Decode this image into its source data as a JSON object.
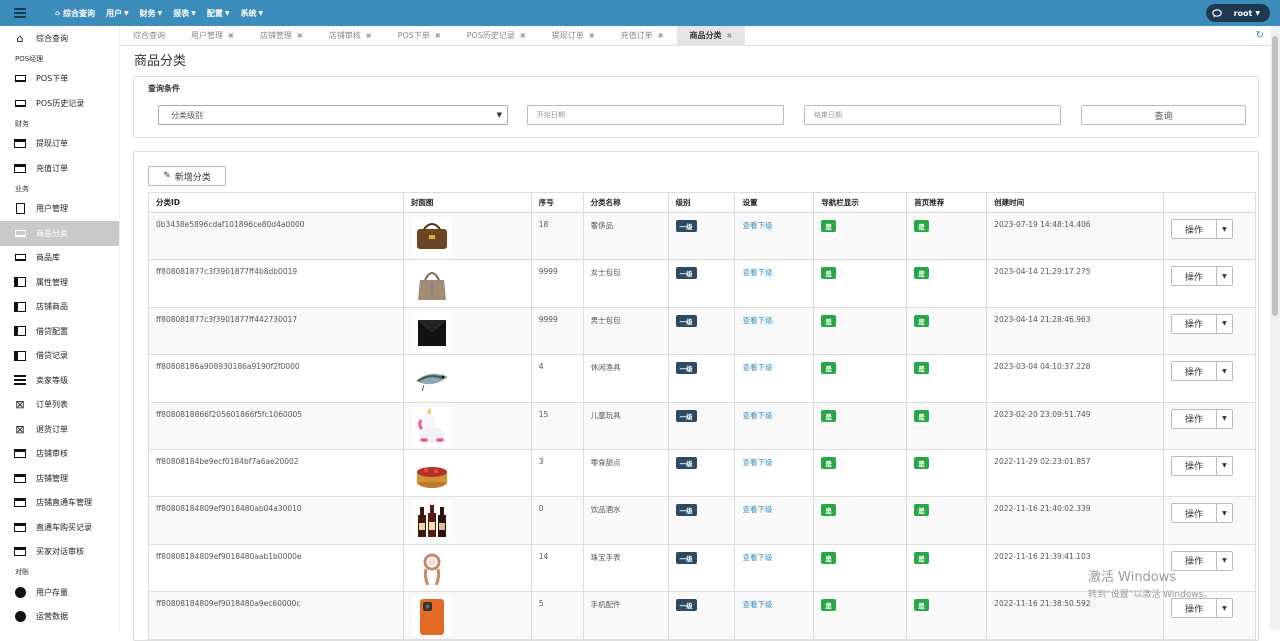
{
  "topbar": {
    "nav": [
      "综合查询",
      "用户",
      "财务",
      "报表",
      "配置",
      "系统"
    ],
    "user": "root"
  },
  "sidebar": [
    {
      "type": "item",
      "label": "综合查询",
      "icon": "home-icon"
    },
    {
      "type": "group",
      "label": "POS经理"
    },
    {
      "type": "item",
      "label": "POS下单",
      "icon": "laptop-icon"
    },
    {
      "type": "item",
      "label": "POS历史记录",
      "icon": "laptop-icon"
    },
    {
      "type": "group",
      "label": "财务"
    },
    {
      "type": "item",
      "label": "提现订单",
      "icon": "card-icon"
    },
    {
      "type": "item",
      "label": "充值订单",
      "icon": "card-icon"
    },
    {
      "type": "group",
      "label": "业务"
    },
    {
      "type": "item",
      "label": "用户管理",
      "icon": "document-icon"
    },
    {
      "type": "item",
      "label": "商品分类",
      "icon": "laptop-icon",
      "active": true
    },
    {
      "type": "item",
      "label": "商品库",
      "icon": "laptop-icon"
    },
    {
      "type": "item",
      "label": "属性管理",
      "icon": "columns-icon"
    },
    {
      "type": "item",
      "label": "店铺商品",
      "icon": "columns-icon"
    },
    {
      "type": "item",
      "label": "借贷配置",
      "icon": "columns-icon"
    },
    {
      "type": "item",
      "label": "借贷记录",
      "icon": "columns-icon"
    },
    {
      "type": "item",
      "label": "卖家等级",
      "icon": "list-icon"
    },
    {
      "type": "item",
      "label": "订单列表",
      "icon": "scissors-icon"
    },
    {
      "type": "item",
      "label": "退货订单",
      "icon": "scissors-icon"
    },
    {
      "type": "item",
      "label": "店铺审核",
      "icon": "card-icon"
    },
    {
      "type": "item",
      "label": "店铺管理",
      "icon": "card-icon"
    },
    {
      "type": "item",
      "label": "店铺直通车管理",
      "icon": "card-icon"
    },
    {
      "type": "item",
      "label": "直通车购买记录",
      "icon": "card-icon"
    },
    {
      "type": "item",
      "label": "买家对话审核",
      "icon": "card-icon"
    },
    {
      "type": "group",
      "label": "对账"
    },
    {
      "type": "item",
      "label": "用户存量",
      "icon": "pie-icon"
    },
    {
      "type": "item",
      "label": "运营数据",
      "icon": "pie-icon"
    }
  ],
  "tabs": [
    {
      "label": "综合查询",
      "closable": false
    },
    {
      "label": "用户管理",
      "closable": true
    },
    {
      "label": "店铺管理",
      "closable": true
    },
    {
      "label": "店铺审核",
      "closable": true
    },
    {
      "label": "POS下单",
      "closable": true
    },
    {
      "label": "POS历史记录",
      "closable": true
    },
    {
      "label": "提现订单",
      "closable": true
    },
    {
      "label": "充值订单",
      "closable": true
    },
    {
      "label": "商品分类",
      "closable": true,
      "active": true
    }
  ],
  "page_title": "商品分类",
  "query": {
    "title": "查询条件",
    "level_select": "分类级别",
    "start_date_placeholder": "开始日期",
    "end_date_placeholder": "结束日期",
    "search_label": "查询"
  },
  "list": {
    "add_label": "新增分类",
    "columns": [
      "分类ID",
      "封面图",
      "序号",
      "分类名称",
      "级别",
      "设置",
      "导航栏显示",
      "首页推荐",
      "创建时间",
      ""
    ],
    "action_label": "操作",
    "rows": [
      {
        "id": "0b3438e5896cdaf101896ce80d4a0000",
        "img": "handbag",
        "seq": "18",
        "name": "奢侈品",
        "level": "一级",
        "setting": "查看下级",
        "nav": "是",
        "home": "是",
        "created": "2023-07-19 14:48:14.406"
      },
      {
        "id": "ff808081877c3f3901877ff4b8db0019",
        "img": "tote",
        "seq": "9999",
        "name": "女士包包",
        "level": "一级",
        "setting": "查看下级",
        "nav": "是",
        "home": "是",
        "created": "2023-04-14 21:29:17.275"
      },
      {
        "id": "ff808081877c3f3901877ff442730017",
        "img": "clutch",
        "seq": "9999",
        "name": "男士包包",
        "level": "一级",
        "setting": "查看下级",
        "nav": "是",
        "home": "是",
        "created": "2023-04-14 21:28:46.963"
      },
      {
        "id": "ff80808186a908930186a9190f2f0000",
        "img": "lure",
        "seq": "4",
        "name": "休闲渔具",
        "level": "一级",
        "setting": "查看下级",
        "nav": "是",
        "home": "是",
        "created": "2023-03-04 04:10:37.228"
      },
      {
        "id": "ff8080818866f205601866f5fc1060005",
        "img": "unicorn",
        "seq": "15",
        "name": "儿童玩具",
        "level": "一级",
        "setting": "查看下级",
        "nav": "是",
        "home": "是",
        "created": "2023-02-20 23:09:51.749"
      },
      {
        "id": "ff80808184be9ecf0184bf7a6ae20002",
        "img": "cake",
        "seq": "3",
        "name": "零食甜点",
        "level": "一级",
        "setting": "查看下级",
        "nav": "是",
        "home": "是",
        "created": "2022-11-29 02:23:01.857"
      },
      {
        "id": "ff80808184809ef9018480ab04a30010",
        "img": "wine",
        "seq": "0",
        "name": "饮品酒水",
        "level": "一级",
        "setting": "查看下级",
        "nav": "是",
        "home": "是",
        "created": "2022-11-16 21:40:02.339"
      },
      {
        "id": "ff80808184809ef9018480aab1b0000e",
        "img": "watch",
        "seq": "14",
        "name": "珠宝手表",
        "level": "一级",
        "setting": "查看下级",
        "nav": "是",
        "home": "是",
        "created": "2022-11-16 21:39:41.103"
      },
      {
        "id": "ff80808184809ef9018480a9ec60000c",
        "img": "phone",
        "seq": "5",
        "name": "手机配件",
        "level": "一级",
        "setting": "查看下级",
        "nav": "是",
        "home": "是",
        "created": "2022-11-16 21:38:50.592"
      }
    ]
  },
  "watermark": {
    "line1": "激活 Windows",
    "line2": "转到“设置”以激活 Windows。"
  },
  "colors": {
    "topbar": "#3c8dbc",
    "level_badge": "#2e4a63",
    "yes_badge": "#27a844",
    "link": "#3c8dbc"
  }
}
